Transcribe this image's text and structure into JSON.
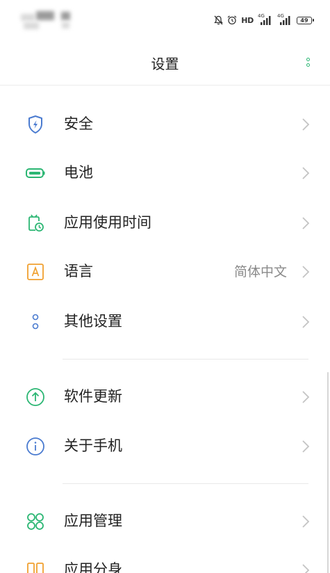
{
  "header": {
    "title": "设置"
  },
  "status_bar": {
    "hd": "HD",
    "network_1": "4G",
    "network_2": "4G",
    "battery": "49"
  },
  "colors": {
    "accent": "#2bb673",
    "security": "#4a7bd0",
    "battery": "#2bb673",
    "app_usage": "#2bb673",
    "language": "#f0a030",
    "other": "#4a7bd0",
    "update": "#2bb673",
    "about": "#4a7bd0",
    "app_manage": "#2bb673",
    "clone": "#f0a030"
  },
  "settings": {
    "groups": [
      {
        "items": [
          {
            "label": "安全",
            "icon": "shield-icon"
          },
          {
            "label": "电池",
            "icon": "battery-icon"
          },
          {
            "label": "应用使用时间",
            "icon": "app-usage-time-icon"
          },
          {
            "label": "语言",
            "value": "简体中文",
            "icon": "language-icon"
          },
          {
            "label": "其他设置",
            "icon": "other-settings-icon"
          }
        ]
      },
      {
        "items": [
          {
            "label": "软件更新",
            "icon": "software-update-icon"
          },
          {
            "label": "关于手机",
            "icon": "info-icon"
          }
        ]
      },
      {
        "items": [
          {
            "label": "应用管理",
            "icon": "app-management-icon"
          },
          {
            "label": "应用分身",
            "icon": "app-clone-icon"
          }
        ]
      }
    ]
  }
}
